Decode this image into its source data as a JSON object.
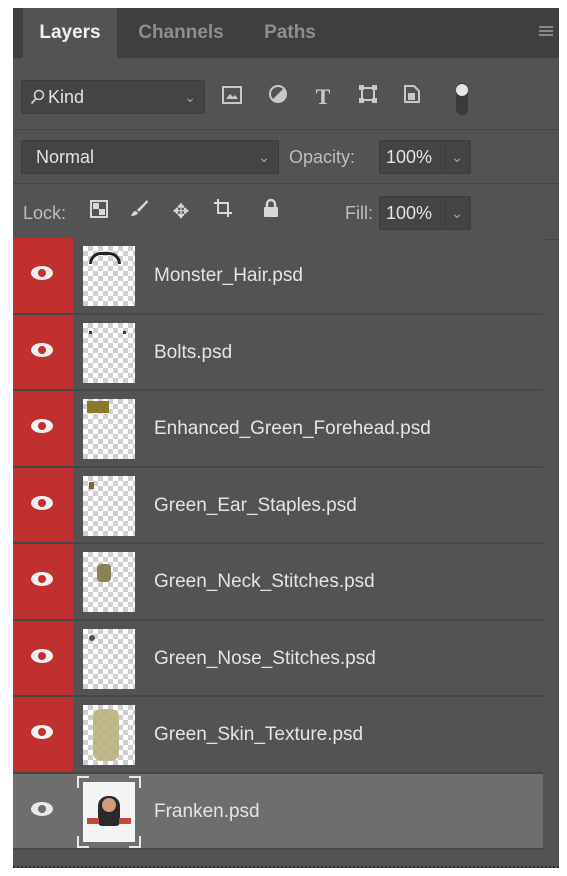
{
  "tabs": [
    {
      "label": "Layers",
      "active": true
    },
    {
      "label": "Channels",
      "active": false
    },
    {
      "label": "Paths",
      "active": false
    }
  ],
  "filter": {
    "kind_label": "Kind",
    "icons": [
      "image-filter-icon",
      "adjustment-filter-icon",
      "type-filter-icon",
      "shape-filter-icon",
      "smart-object-filter-icon",
      "filter-toggle-icon"
    ]
  },
  "blend": {
    "mode": "Normal",
    "opacity_label": "Opacity:",
    "opacity_value": "100%"
  },
  "lock": {
    "label": "Lock:",
    "fill_label": "Fill:",
    "fill_value": "100%"
  },
  "layers": [
    {
      "name": "Monster_Hair.psd",
      "visible": true,
      "highlighted": true
    },
    {
      "name": "Bolts.psd",
      "visible": true,
      "highlighted": true
    },
    {
      "name": "Enhanced_Green_Forehead.psd",
      "visible": true,
      "highlighted": true
    },
    {
      "name": "Green_Ear_Staples.psd",
      "visible": true,
      "highlighted": true
    },
    {
      "name": "Green_Neck_Stitches.psd",
      "visible": true,
      "highlighted": true
    },
    {
      "name": "Green_Nose_Stitches.psd",
      "visible": true,
      "highlighted": true
    },
    {
      "name": "Green_Skin_Texture.psd",
      "visible": true,
      "highlighted": true
    },
    {
      "name": "Franken.psd",
      "visible": true,
      "highlighted": false,
      "selected": true
    }
  ],
  "colors": {
    "panel_bg": "#535353",
    "visibility_highlight": "#c0302f",
    "selected_row": "#6e6e6e"
  }
}
